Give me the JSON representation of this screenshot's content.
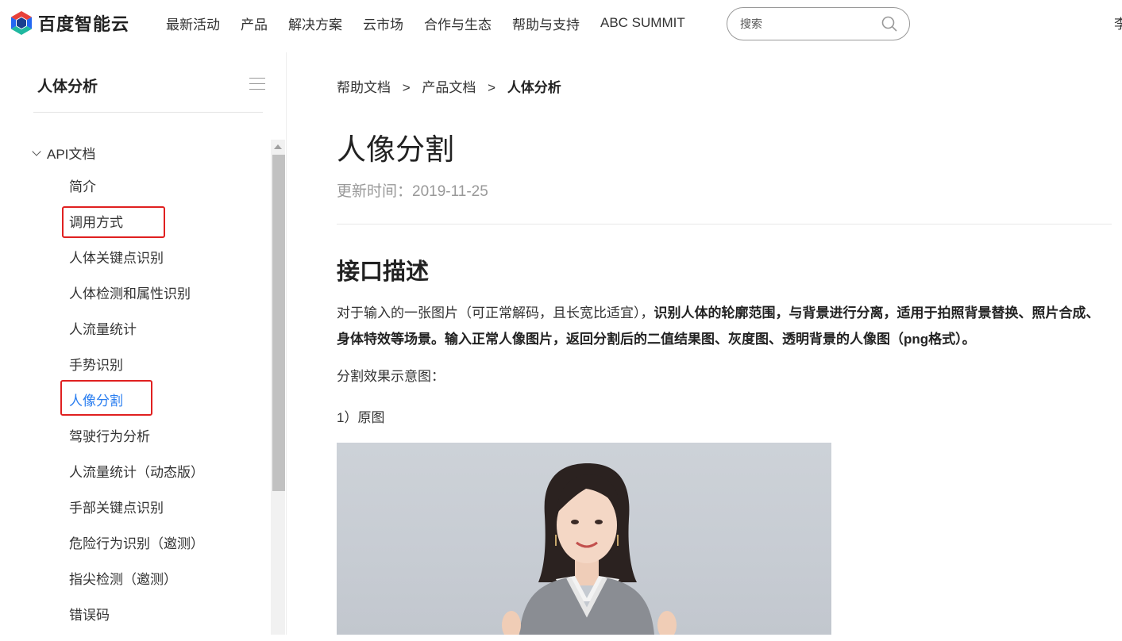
{
  "brand": {
    "name": "百度智能云"
  },
  "nav": {
    "items": [
      "最新活动",
      "产品",
      "解决方案",
      "云市场",
      "合作与生态",
      "帮助与支持",
      "ABC SUMMIT"
    ],
    "search_placeholder": "搜索",
    "user_partial": "李"
  },
  "sidebar": {
    "title": "人体分析",
    "section": "API文档",
    "items": [
      "简介",
      "调用方式",
      "人体关键点识别",
      "人体检测和属性识别",
      "人流量统计",
      "手势识别",
      "人像分割",
      "驾驶行为分析",
      "人流量统计（动态版）",
      "手部关键点识别",
      "危险行为识别（邀测）",
      "指尖检测（邀测）",
      "错误码"
    ],
    "active_item": "人像分割"
  },
  "breadcrumb": {
    "items": [
      "帮助文档",
      "产品文档",
      "人体分析"
    ],
    "separator": ">"
  },
  "page": {
    "title": "人像分割",
    "updated": "更新时间：2019-11-25",
    "section_title": "接口描述",
    "desc_plain": "对于输入的一张图片（可正常解码，且长宽比适宜），",
    "desc_bold": "识别人体的轮廓范围，与背景进行分离，适用于拍照背景替换、照片合成、身体特效等场景。输入正常人像图片，返回分割后的二值结果图、灰度图、透明背景的人像图（png格式）。",
    "effect_label": "分割效果示意图：",
    "original_label": "1）原图"
  },
  "colors": {
    "active_link": "#2a7ef0",
    "highlight_box": "#e02020",
    "logo_blue": "#2468f2",
    "logo_green": "#1fb8a0"
  }
}
